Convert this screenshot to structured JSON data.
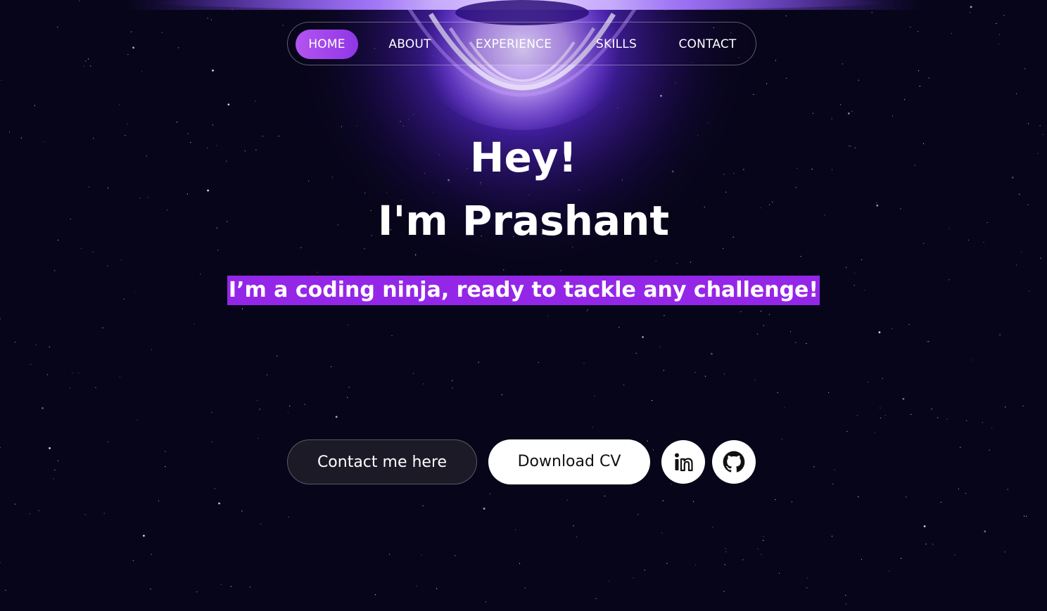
{
  "nav": {
    "items": [
      {
        "label": "HOME",
        "active": true
      },
      {
        "label": "ABOUT",
        "active": false
      },
      {
        "label": "EXPERIENCE",
        "active": false
      },
      {
        "label": "SKILLS",
        "active": false
      },
      {
        "label": "CONTACT",
        "active": false
      }
    ]
  },
  "hero": {
    "greeting": "Hey!",
    "name": "I'm Prashant",
    "tagline": "I’m a coding ninja, ready to tackle any challenge!"
  },
  "actions": {
    "contact_label": "Contact me here",
    "cv_label": "Download CV",
    "linkedin_icon": "linkedin-icon",
    "github_icon": "github-icon"
  },
  "colors": {
    "background": "#07051a",
    "accent": "#9426e8",
    "nav_active": "#b455f0",
    "glow": "#7b3cff"
  }
}
